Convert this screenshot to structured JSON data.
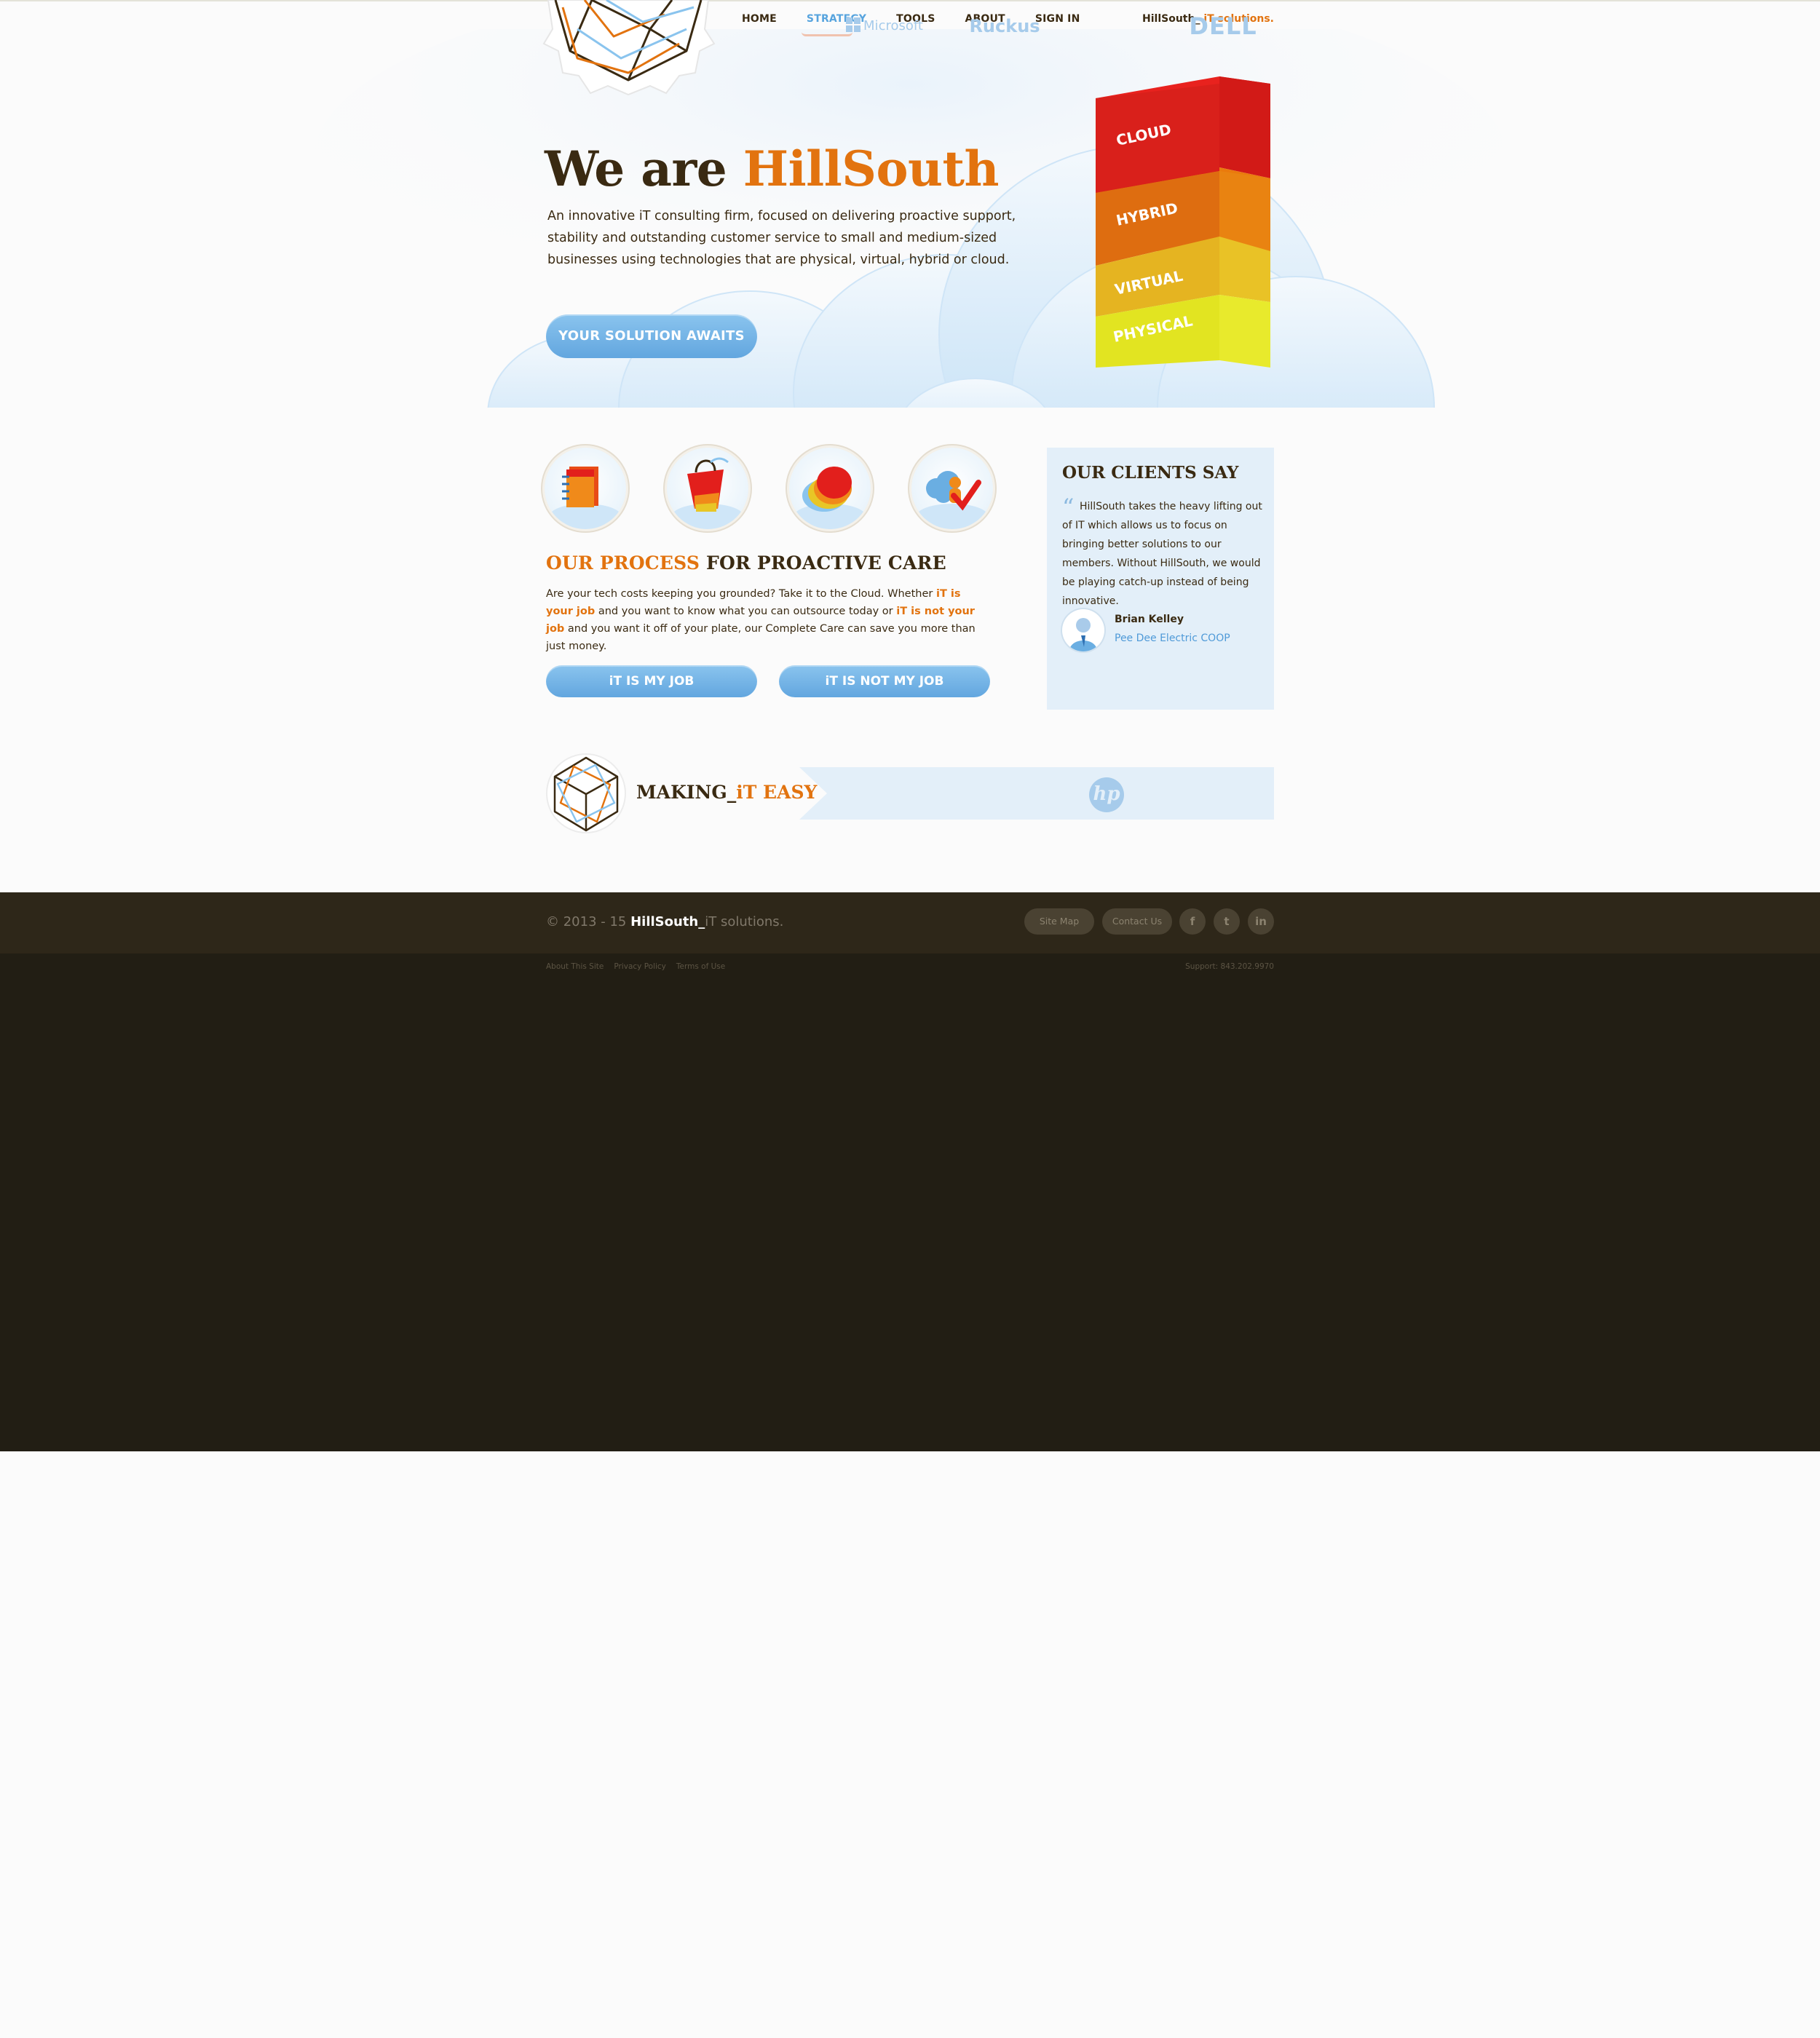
{
  "header": {
    "nav": [
      "HOME",
      "STRATEGY",
      "TOOLS",
      "ABOUT",
      "SIGN IN"
    ],
    "active_nav": "STRATEGY",
    "tagline_brand": "HillSouth_",
    "tagline_accent": "iT solutions."
  },
  "hero": {
    "title_prefix": "We are ",
    "title_brand": "HillSouth",
    "description": "An innovative iT consulting firm, focused on delivering proactive support, stability and outstanding customer service to small and medium-sized businesses using technologies that are physical, virtual, hybrid or cloud.",
    "cta": "YOUR SOLUTION AWAITS",
    "tower_layers": [
      "CLOUD",
      "HYBRID",
      "VIRTUAL",
      "PHYSICAL"
    ]
  },
  "process": {
    "icons": [
      "notebook-icon",
      "shopping-bag-icon",
      "speech-bubble-icon",
      "cloud-check-icon"
    ],
    "title_accent": "OUR PROCESS",
    "title_rest": " FOR PROACTIVE CARE",
    "text_1": "Are your tech costs keeping you grounded? Take it to the Cloud. Whether ",
    "link_1": "iT is your job",
    "text_2": " and you want to know what you can outsource today or ",
    "link_2": "iT is not your job",
    "text_3": " and you want it off of your plate, our Complete Care can save you more than just money.",
    "button_1": "iT IS MY JOB",
    "button_2": "iT IS NOT MY JOB"
  },
  "testimonial": {
    "title": "OUR CLIENTS SAY",
    "quote": "HillSouth takes the heavy lifting out of IT which allows us to focus on bringing better solutions to our members. Without HillSouth, we would be playing catch-up instead of being innovative.",
    "author": "Brian Kelley",
    "organization": "Pee Dee Electric COOP"
  },
  "partners": {
    "title_dark": "MAKING_",
    "title_accent": "iT EASY",
    "logos": [
      "Microsoft",
      "Ruckus",
      "hp",
      "DELL"
    ]
  },
  "footer": {
    "copyright_prefix": "© 2013 - 15 ",
    "copyright_brand": "HillSouth_",
    "copyright_suffix": "iT solutions.",
    "buttons": [
      "Site Map",
      "Contact Us"
    ],
    "social": [
      "f",
      "t",
      "in"
    ],
    "legal_links": [
      "About This Site",
      "Privacy Policy",
      "Terms of Use"
    ],
    "support": "Support: 843.202.9970"
  },
  "colors": {
    "brand_dark": "#3a2a12",
    "brand_orange": "#e2730f",
    "accent_blue": "#57a4de",
    "footer_dark": "#221e14"
  }
}
